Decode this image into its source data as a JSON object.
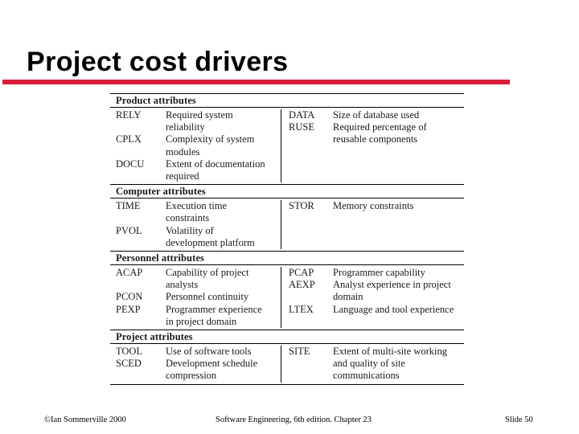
{
  "slide": {
    "title": "Project cost drivers",
    "accent_color": "#d81e3c"
  },
  "table": {
    "sections": [
      {
        "heading": "Product attributes",
        "left": [
          {
            "code": "RELY",
            "lines": [
              "Required system",
              "reliability"
            ]
          },
          {
            "code": "CPLX",
            "lines": [
              "Complexity of system",
              "modules"
            ]
          },
          {
            "code": "DOCU",
            "lines": [
              "Extent of documentation",
              "required"
            ]
          }
        ],
        "right": [
          {
            "code": "DATA",
            "lines": [
              "Size of database used"
            ]
          },
          {
            "code": "RUSE",
            "lines": [
              "Required percentage of",
              "reusable components"
            ]
          }
        ]
      },
      {
        "heading": "Computer attributes",
        "left": [
          {
            "code": "TIME",
            "lines": [
              "Execution time",
              "constraints"
            ]
          },
          {
            "code": "PVOL",
            "lines": [
              "Volatility of",
              "development platform"
            ]
          }
        ],
        "right": [
          {
            "code": "STOR",
            "lines": [
              "Memory constraints"
            ]
          }
        ]
      },
      {
        "heading": "Personnel attributes",
        "left": [
          {
            "code": "ACAP",
            "lines": [
              "Capability of project",
              "analysts"
            ]
          },
          {
            "code": "PCON",
            "lines": [
              "Personnel continuity"
            ]
          },
          {
            "code": "PEXP",
            "lines": [
              "Programmer experience",
              "in project domain"
            ]
          }
        ],
        "right": [
          {
            "code": "PCAP",
            "lines": [
              "Programmer capability"
            ]
          },
          {
            "code": "AEXP",
            "lines": [
              "Analyst experience in project",
              "domain"
            ]
          },
          {
            "code": "LTEX",
            "lines": [
              "Language and tool experience"
            ]
          }
        ]
      },
      {
        "heading": "Project attributes",
        "left": [
          {
            "code": "TOOL",
            "lines": [
              "Use of software tools"
            ]
          },
          {
            "code": "SCED",
            "lines": [
              "Development schedule",
              "compression"
            ]
          }
        ],
        "right": [
          {
            "code": "SITE",
            "lines": [
              "Extent of multi-site working",
              "and quality of site",
              "communications"
            ]
          }
        ]
      }
    ]
  },
  "footer": {
    "copyright": "©Ian Sommerville 2000",
    "center": "Software Engineering, 6th edition. Chapter 23",
    "slide_number": "Slide 50"
  }
}
